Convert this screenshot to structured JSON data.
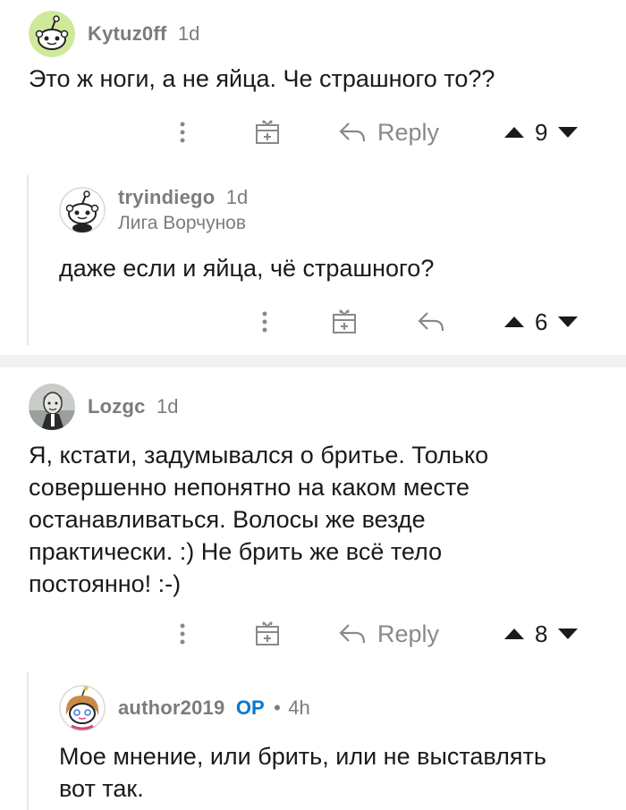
{
  "comments": [
    {
      "username": "Kytuz0ff",
      "time": "1d",
      "body": "Это ж ноги, а не яйца. Че страшного то??",
      "reply_label": "Reply",
      "score": "9"
    },
    {
      "username": "tryindiego",
      "time": "1d",
      "flair": "Лига Ворчунов",
      "body": "даже если и яйца, чё страшного?",
      "score": "6"
    },
    {
      "username": "Lozgc",
      "time": "1d",
      "body_lines": [
        "Я, кстати, задумывался о бритье. Только",
        "совершенно непонятно на каком месте",
        "останавливаться. Волосы же везде",
        "практически. :) Не брить же всё тело",
        "постоянно! :-)"
      ],
      "reply_label": "Reply",
      "score": "8"
    },
    {
      "username": "author2019",
      "op_badge": "OP",
      "separator": "•",
      "time": "4h",
      "body_lines": [
        "Мое мнение, или брить, или не выставлять",
        "вот так."
      ]
    }
  ],
  "colors": {
    "accent_op": "#0079d3",
    "meta_gray": "#7c7c7c",
    "icon_gray": "#878a8c",
    "separator_bg": "#f0f1f2"
  },
  "icons": [
    "more-options-icon",
    "award-icon",
    "reply-arrow-icon",
    "upvote-icon",
    "downvote-icon",
    "snoo-avatar-icon"
  ]
}
